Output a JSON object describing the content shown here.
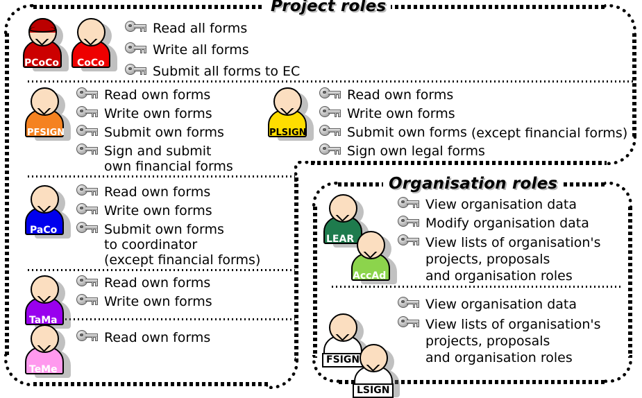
{
  "groups": [
    {
      "id": "project-roles",
      "title": "Project roles",
      "sections": [
        {
          "id": "coordinators",
          "avatars": [
            {
              "code": "PCoCo",
              "body_color": "#cc0000",
              "text_color": "#ffffff",
              "cap": true,
              "cap_color": "#bb0000",
              "boxed": false
            },
            {
              "code": "CoCo",
              "body_color": "#ee0000",
              "text_color": "#ffffff",
              "cap": false,
              "boxed": false
            }
          ],
          "permissions": [
            {
              "text": "Read all forms"
            },
            {
              "text": "Write all forms"
            },
            {
              "text": "Submit all forms to EC"
            }
          ]
        },
        {
          "id": "pfsign",
          "avatars": [
            {
              "code": "PFSIGN",
              "body_color": "#f58220",
              "text_color": "#ffffff",
              "cap": false,
              "boxed": false
            }
          ],
          "permissions": [
            {
              "text": "Read own forms"
            },
            {
              "text": "Write own forms"
            },
            {
              "text": "Submit own forms"
            },
            {
              "text": "Sign and submit\nown financial forms"
            }
          ]
        },
        {
          "id": "plsign",
          "avatars": [
            {
              "code": "PLSIGN",
              "body_color": "#ffdd00",
              "text_color": "#000000",
              "cap": false,
              "boxed": false
            }
          ],
          "permissions": [
            {
              "text": "Read own forms"
            },
            {
              "text": "Write own forms"
            },
            {
              "text": "Submit own forms",
              "note": "(except financial forms)"
            },
            {
              "text": "Sign own legal forms"
            }
          ]
        },
        {
          "id": "paco",
          "avatars": [
            {
              "code": "PaCo",
              "body_color": "#0000ee",
              "text_color": "#ffffff",
              "cap": false,
              "boxed": false
            }
          ],
          "permissions": [
            {
              "text": "Read own forms"
            },
            {
              "text": "Write own forms"
            },
            {
              "text": "Submit own forms\nto coordinator",
              "sub": "(except financial forms)"
            }
          ]
        },
        {
          "id": "tama",
          "avatars": [
            {
              "code": "TaMa",
              "body_color": "#9900ee",
              "text_color": "#ffffff",
              "cap": false,
              "boxed": false
            }
          ],
          "permissions": [
            {
              "text": "Read own forms"
            },
            {
              "text": "Write own forms"
            }
          ]
        },
        {
          "id": "teme",
          "avatars": [
            {
              "code": "TeMe",
              "body_color": "#ff99ee",
              "text_color": "#ffffff",
              "cap": false,
              "boxed": false
            }
          ],
          "permissions": [
            {
              "text": "Read own forms"
            }
          ]
        }
      ]
    },
    {
      "id": "organisation-roles",
      "title": "Organisation roles",
      "sections": [
        {
          "id": "lear-accad",
          "avatars": [
            {
              "code": "LEAR",
              "body_color": "#1e7b4d",
              "text_color": "#ffffff",
              "cap": false,
              "boxed": false
            },
            {
              "code": "AccAd",
              "body_color": "#8cd44c",
              "text_color": "#ffffff",
              "cap": false,
              "boxed": false
            }
          ],
          "permissions": [
            {
              "text": "View organisation data"
            },
            {
              "text": "Modify organisation data"
            },
            {
              "text": "View lists of organisation's\nprojects, proposals\nand organisation roles"
            }
          ]
        },
        {
          "id": "fsign-lsign",
          "avatars": [
            {
              "code": "FSIGN",
              "body_color": "#ffffff",
              "text_color": "#000000",
              "cap": false,
              "boxed": true
            },
            {
              "code": "LSIGN",
              "body_color": "#ffffff",
              "text_color": "#000000",
              "cap": false,
              "boxed": true
            }
          ],
          "permissions": [
            {
              "text": "View organisation data"
            },
            {
              "text": "View lists of organisation's\nprojects, proposals\nand organisation roles"
            }
          ]
        }
      ]
    }
  ],
  "icons": {
    "permission": "key-icon",
    "avatar": "person-avatar-icon"
  },
  "colors": {
    "skin": "#fbdec0",
    "outline": "#000000",
    "background": "#ffffff",
    "shadow": "#6b6b6b"
  }
}
